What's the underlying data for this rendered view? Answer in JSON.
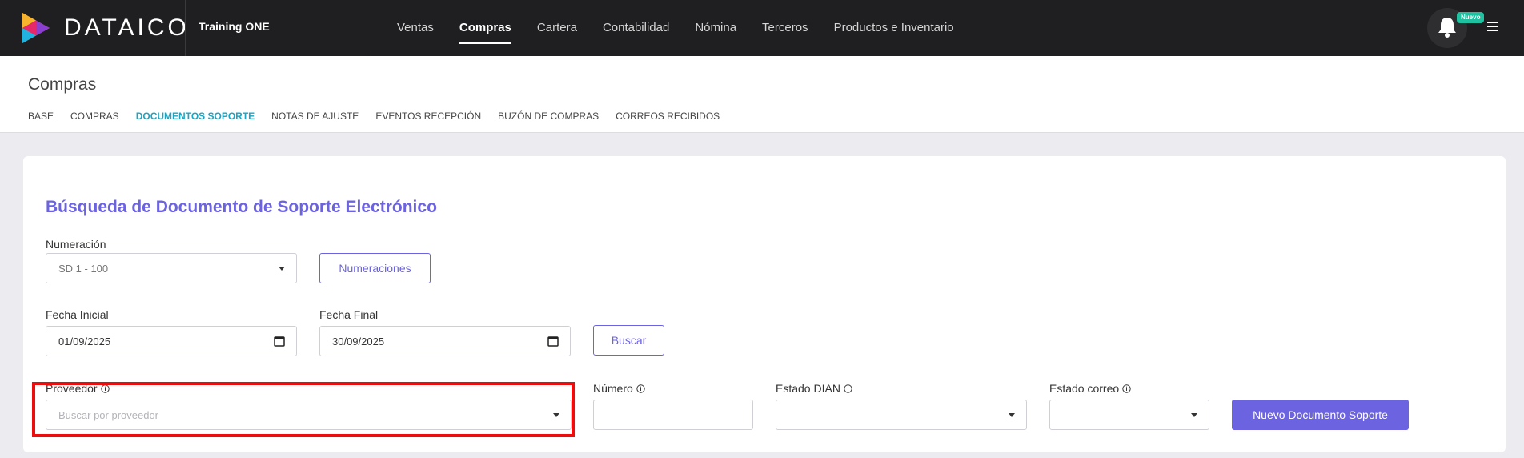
{
  "app": {
    "brand": "DATAICO",
    "company": "Training ONE",
    "nav": [
      "Ventas",
      "Compras",
      "Cartera",
      "Contabilidad",
      "Nómina",
      "Terceros",
      "Productos e Inventario"
    ],
    "active_nav": "Compras",
    "notification_badge": "Nuevo"
  },
  "page": {
    "title": "Compras",
    "tabs": [
      "BASE",
      "COMPRAS",
      "DOCUMENTOS SOPORTE",
      "NOTAS DE AJUSTE",
      "EVENTOS RECEPCIÓN",
      "BUZÓN DE COMPRAS",
      "CORREOS RECIBIDOS"
    ],
    "active_tab": "DOCUMENTOS SOPORTE"
  },
  "form": {
    "title": "Búsqueda de Documento de Soporte Electrónico",
    "numeracion_label": "Numeración",
    "numeracion_value": "SD 1 - 100",
    "numeraciones_button": "Numeraciones",
    "fecha_inicial_label": "Fecha Inicial",
    "fecha_inicial_value": "01/09/2025",
    "fecha_final_label": "Fecha Final",
    "fecha_final_value": "30/09/2025",
    "buscar_button": "Buscar",
    "proveedor_label": "Proveedor",
    "proveedor_placeholder": "Buscar por proveedor",
    "numero_label": "Número",
    "numero_value": "",
    "estado_dian_label": "Estado DIAN",
    "estado_dian_value": "",
    "estado_correo_label": "Estado correo",
    "estado_correo_value": "",
    "nuevo_button": "Nuevo Documento Soporte"
  },
  "colors": {
    "topbar": "#1f1f21",
    "accent": "#6c63e0",
    "active_tab": "#1aa5c4",
    "highlight": "#ee0c0c",
    "badge": "#1fc2a0"
  }
}
